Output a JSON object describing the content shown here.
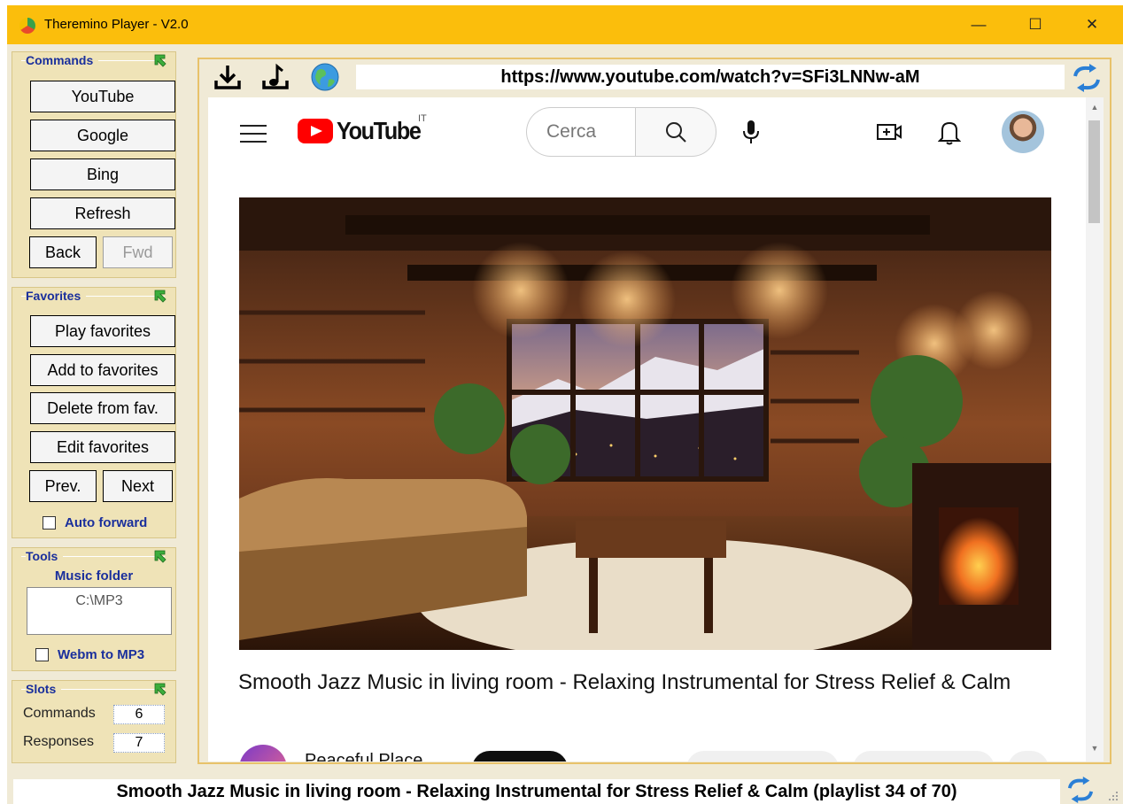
{
  "window": {
    "title": "Theremino Player - V2.0",
    "controls": {
      "minimize": "—",
      "maximize": "☐",
      "close": "✕"
    }
  },
  "commands": {
    "title": "Commands",
    "buttons": {
      "youtube": "YouTube",
      "google": "Google",
      "bing": "Bing",
      "refresh": "Refresh",
      "back": "Back",
      "fwd": "Fwd"
    }
  },
  "favorites": {
    "title": "Favorites",
    "buttons": {
      "play": "Play favorites",
      "add": "Add to favorites",
      "delete": "Delete from fav.",
      "edit": "Edit favorites",
      "prev": "Prev.",
      "next": "Next"
    },
    "auto_forward": {
      "label": "Auto forward",
      "checked": false
    }
  },
  "tools": {
    "title": "Tools",
    "music_folder_label": "Music folder",
    "music_folder_value": "C:\\MP3",
    "webm_to_mp3": {
      "label": "Webm to MP3",
      "checked": false
    }
  },
  "slots": {
    "title": "Slots",
    "commands_label": "Commands",
    "commands_value": "6",
    "responses_label": "Responses",
    "responses_value": "7"
  },
  "browser": {
    "url": "https://www.youtube.com/watch?v=SFi3LNNw-aM",
    "icons": [
      "download-icon",
      "music-note-download-icon",
      "globe-icon",
      "reload-icon"
    ]
  },
  "youtube": {
    "logo_text": "YouTube",
    "country_code": "IT",
    "search_placeholder": "Cerca",
    "video_title": "Smooth Jazz Music in living room - Relaxing Instrumental for Stress Relief & Calm",
    "channel_name": "Peaceful Place",
    "brand_color": "#ff0000"
  },
  "status": {
    "text": "Smooth Jazz Music in living room - Relaxing Instrumental for Stress Relief & Calm   (playlist 34 of 70)"
  },
  "colors": {
    "titlebar": "#fbbe0c",
    "panel_bg": "#efe3b7",
    "panel_title": "#1a2f9c",
    "frame_border": "#e8c26a"
  }
}
